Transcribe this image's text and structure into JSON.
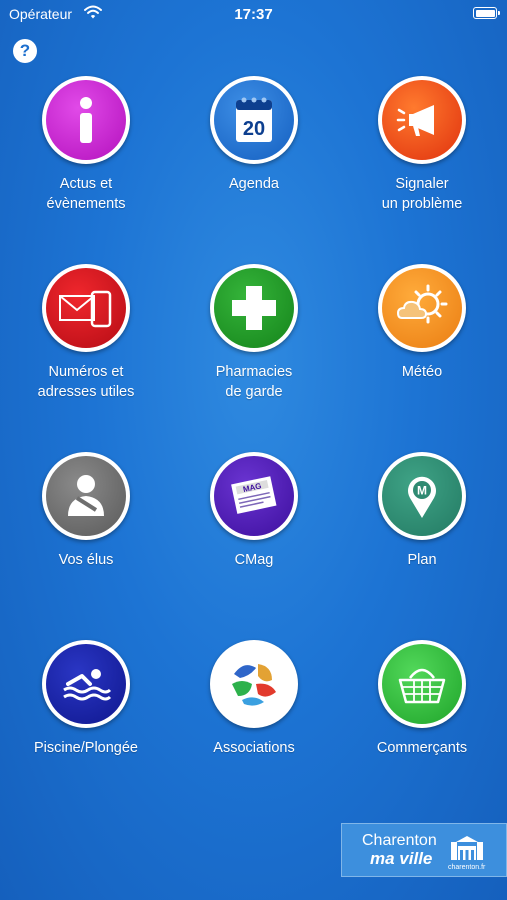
{
  "status_bar": {
    "carrier": "Opérateur",
    "time": "17:37"
  },
  "help": {
    "label": "?"
  },
  "tiles": [
    {
      "label": "Actus et\névènements",
      "icon": "info-icon",
      "color": "#c61fcf"
    },
    {
      "label": "Agenda",
      "icon": "calendar-icon",
      "day": "20",
      "color": "#1a6fd0"
    },
    {
      "label": "Signaler\nun problème",
      "icon": "megaphone-icon",
      "color": "#f14a12"
    },
    {
      "label": "Numéros et\nadresses utiles",
      "icon": "mail-phone-icon",
      "color": "#d4101b"
    },
    {
      "label": "Pharmacies\nde garde",
      "icon": "pharmacy-cross-icon",
      "color": "#1d9a23"
    },
    {
      "label": "Météo",
      "icon": "weather-sun-cloud-icon",
      "color": "#f7931e"
    },
    {
      "label": "Vos élus",
      "icon": "person-icon",
      "color": "#6e6e6e"
    },
    {
      "label": "CMag",
      "icon": "magazine-icon",
      "magazine_text": "MAG",
      "color": "#4b18b2"
    },
    {
      "label": "Plan",
      "icon": "map-pin-icon",
      "pin_letter": "M",
      "color": "#2f8a72"
    },
    {
      "label": "Piscine/Plongée",
      "icon": "swimmer-icon",
      "color": "#1922a8"
    },
    {
      "label": "Associations",
      "icon": "associations-logo-icon",
      "color": "#ffffff"
    },
    {
      "label": "Commerçants",
      "icon": "shopping-basket-icon",
      "color": "#2fc23a"
    }
  ],
  "brand": {
    "line1": "Charenton",
    "line2": "ma ville",
    "site": "charenton.fr"
  }
}
